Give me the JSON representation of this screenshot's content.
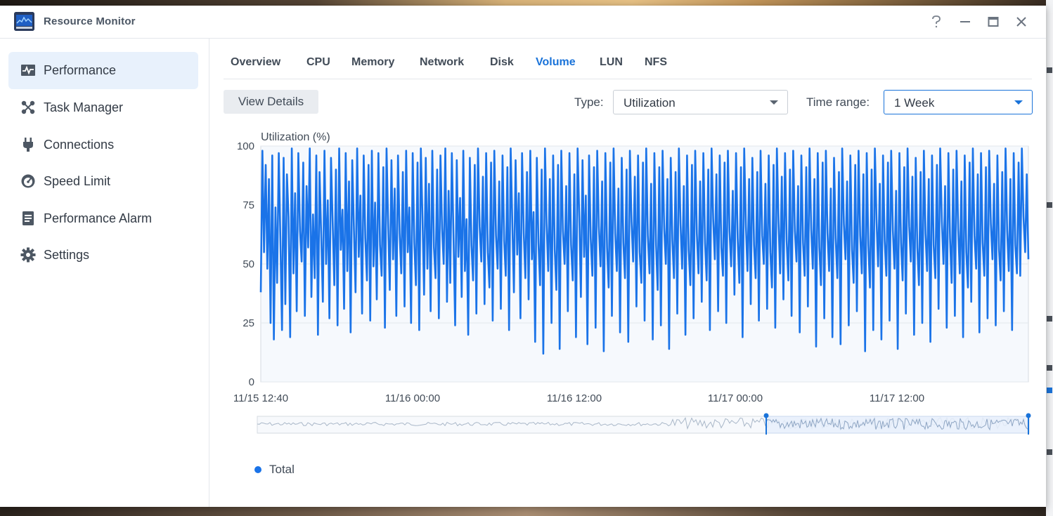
{
  "window": {
    "title": "Resource Monitor",
    "help_icon": "help-icon",
    "minimize_icon": "minimize-icon",
    "maximize_icon": "maximize-icon",
    "close_icon": "close-icon"
  },
  "sidebar": {
    "items": [
      {
        "label": "Performance",
        "icon": "performance-icon",
        "active": true
      },
      {
        "label": "Task Manager",
        "icon": "task-manager-icon",
        "active": false
      },
      {
        "label": "Connections",
        "icon": "plug-icon",
        "active": false
      },
      {
        "label": "Speed Limit",
        "icon": "speedometer-icon",
        "active": false
      },
      {
        "label": "Performance Alarm",
        "icon": "alarm-list-icon",
        "active": false
      },
      {
        "label": "Settings",
        "icon": "gear-icon",
        "active": false
      }
    ]
  },
  "tabs": [
    {
      "label": "Overview",
      "active": false
    },
    {
      "label": "CPU",
      "active": false
    },
    {
      "label": "Memory",
      "active": false
    },
    {
      "label": "Network",
      "active": false
    },
    {
      "label": "Disk",
      "active": false
    },
    {
      "label": "Volume",
      "active": true
    },
    {
      "label": "LUN",
      "active": false
    },
    {
      "label": "NFS",
      "active": false
    }
  ],
  "toolbar": {
    "view_details_label": "View Details",
    "type_label": "Type:",
    "type_value": "Utilization",
    "time_range_label": "Time range:",
    "time_range_value": "1 Week"
  },
  "colors": {
    "accent": "#1a73d9",
    "series": "#1a73e8",
    "active_sidebar_bg": "#e8f1fc",
    "navigator_fill": "#e8f0fb"
  },
  "chart_data": {
    "type": "line",
    "ylabel": "Utilization (%)",
    "ylim": [
      0,
      100
    ],
    "y_ticks": [
      0,
      25,
      50,
      75,
      100
    ],
    "x_tick_labels": [
      "11/15 12:40",
      "11/16 00:00",
      "11/16 12:00",
      "11/17 00:00",
      "11/17 12:00"
    ],
    "x_range": [
      "11/15 12:40",
      "11/17 21:10"
    ],
    "grid": true,
    "legend_position": "bottom-left",
    "series": [
      {
        "name": "Total",
        "values": [
          38,
          98,
          55,
          92,
          48,
          86,
          25,
          96,
          18,
          74,
          42,
          97,
          60,
          22,
          95,
          33,
          88,
          70,
          19,
          99,
          46,
          80,
          30,
          97,
          64,
          51,
          93,
          28,
          83,
          57,
          99,
          36,
          71,
          44,
          96,
          20,
          89,
          62,
          34,
          98,
          50,
          77,
          27,
          95,
          68,
          41,
          90,
          24,
          99,
          56,
          73,
          31,
          97,
          47,
          85,
          21,
          94,
          66,
          38,
          99,
          53,
          79,
          29,
          96,
          61,
          43,
          92,
          26,
          98,
          49,
          76,
          35,
          97,
          58,
          45,
          91,
          23,
          99,
          67,
          39,
          94,
          52,
          82,
          28,
          96,
          63,
          46,
          89,
          32,
          98,
          55,
          74,
          25,
          97,
          59,
          41,
          93,
          22,
          99,
          70,
          37,
          95,
          48,
          84,
          30,
          98,
          57,
          44,
          90,
          27,
          96,
          65,
          50,
          99,
          34,
          81,
          42,
          97,
          61,
          24,
          94,
          53,
          78,
          36,
          98,
          47,
          69,
          20,
          95,
          58,
          43,
          92,
          29,
          99,
          66,
          51,
          87,
          33,
          97,
          55,
          40,
          93,
          26,
          98,
          62,
          48,
          85,
          31,
          96,
          60,
          45,
          91,
          22,
          99,
          68,
          38,
          94,
          54,
          80,
          27,
          97,
          63,
          44,
          89,
          35,
          98,
          52,
          72,
          17,
          95,
          59,
          41,
          90,
          12,
          99,
          67,
          47,
          86,
          25,
          96,
          56,
          39,
          92,
          14,
          98,
          64,
          50,
          83,
          30,
          97,
          58,
          43,
          88,
          19,
          99,
          70,
          36,
          94,
          53,
          79,
          16,
          96,
          61,
          45,
          91,
          23,
          98,
          66,
          49,
          85,
          13,
          97,
          57,
          40,
          93,
          28,
          99,
          63,
          47,
          82,
          21,
          95,
          59,
          44,
          90,
          17,
          98,
          68,
          51,
          87,
          32,
          96,
          55,
          42,
          93,
          26,
          99,
          62,
          46,
          84,
          18,
          97,
          58,
          39,
          91,
          24,
          98,
          65,
          50,
          86,
          14,
          95,
          60,
          44,
          89,
          29,
          99,
          67,
          48,
          83,
          20,
          96,
          56,
          41,
          92,
          27,
          98,
          63,
          46,
          85,
          34,
          97,
          59,
          43,
          90,
          22,
          99,
          69,
          52,
          88,
          30,
          96,
          57,
          45,
          93,
          25,
          98,
          64,
          49,
          81,
          37,
          97,
          61,
          42,
          91,
          19,
          99,
          66,
          47,
          86,
          33,
          95,
          58,
          44,
          89,
          26,
          98,
          62,
          50,
          84,
          31,
          96,
          55,
          40,
          92,
          23,
          99,
          68,
          46,
          87,
          35,
          97,
          60,
          43,
          90,
          28,
          98,
          64,
          51,
          83,
          21,
          96,
          59,
          45,
          91,
          32,
          99,
          65,
          48,
          86,
          15,
          97,
          57,
          41,
          93,
          27,
          98,
          63,
          47,
          82,
          19,
          95,
          61,
          44,
          89,
          16,
          99,
          67,
          52,
          85,
          24,
          96,
          56,
          42,
          92,
          30,
          98,
          62,
          46,
          88,
          13,
          97,
          58,
          40,
          90,
          22,
          99,
          69,
          49,
          84,
          18,
          96,
          60,
          45,
          93,
          26,
          98,
          64,
          48,
          81,
          14,
          97,
          59,
          43,
          91,
          29,
          99,
          66,
          51,
          87,
          20,
          95,
          57,
          41,
          89,
          25,
          98,
          63,
          47,
          86,
          17,
          96,
          58,
          44,
          92,
          31,
          99,
          68,
          50,
          83,
          23,
          97,
          61,
          42,
          90,
          28,
          98,
          65,
          46,
          85,
          19,
          96,
          55,
          40,
          93,
          34,
          99,
          62,
          48,
          88,
          21,
          97,
          59,
          45,
          91,
          27,
          98,
          67,
          52,
          84,
          24,
          96,
          56,
          43,
          89,
          30,
          99,
          64,
          47,
          86,
          22,
          97,
          58,
          46,
          93,
          45,
          99,
          70,
          55,
          88,
          52
        ]
      }
    ],
    "navigator": {
      "range_start": "11/15 12:40",
      "range_end": "11/17 21:10"
    }
  }
}
